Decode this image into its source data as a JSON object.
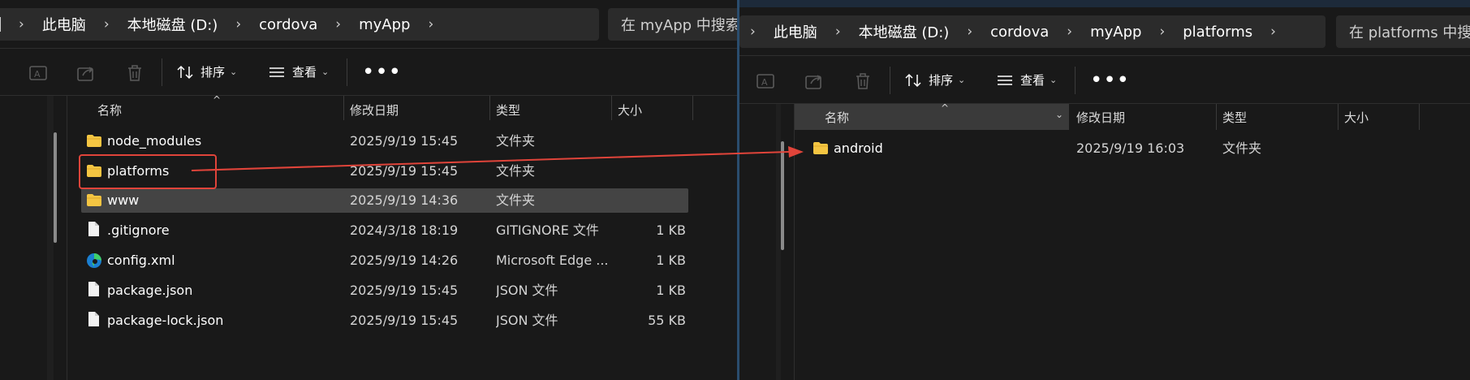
{
  "left": {
    "breadcrumb": [
      "此电脑",
      "本地磁盘 (D:)",
      "cordova",
      "myApp"
    ],
    "search_placeholder": "在 myApp 中搜索",
    "toolbar": {
      "sort_label": "排序",
      "view_label": "查看",
      "more_label": "•••"
    },
    "columns": {
      "name": "名称",
      "date": "修改日期",
      "type": "类型",
      "size": "大小"
    },
    "rows": [
      {
        "icon": "folder-icon",
        "name": "node_modules",
        "date": "2025/9/19 15:45",
        "type": "文件夹",
        "size": ""
      },
      {
        "icon": "folder-icon",
        "name": "platforms",
        "date": "2025/9/19 15:45",
        "type": "文件夹",
        "size": ""
      },
      {
        "icon": "folder-icon",
        "name": "www",
        "date": "2025/9/19 14:36",
        "type": "文件夹",
        "size": "",
        "selected": true
      },
      {
        "icon": "file-icon",
        "name": ".gitignore",
        "date": "2024/3/18 18:19",
        "type": "GITIGNORE 文件",
        "size": "1 KB"
      },
      {
        "icon": "edge-icon",
        "name": "config.xml",
        "date": "2025/9/19 14:26",
        "type": "Microsoft Edge ...",
        "size": "1 KB"
      },
      {
        "icon": "file-icon",
        "name": "package.json",
        "date": "2025/9/19 15:45",
        "type": "JSON 文件",
        "size": "1 KB"
      },
      {
        "icon": "file-icon",
        "name": "package-lock.json",
        "date": "2025/9/19 15:45",
        "type": "JSON 文件",
        "size": "55 KB"
      }
    ]
  },
  "right": {
    "breadcrumb": [
      "此电脑",
      "本地磁盘 (D:)",
      "cordova",
      "myApp",
      "platforms"
    ],
    "search_placeholder": "在 platforms 中搜索",
    "toolbar": {
      "sort_label": "排序",
      "view_label": "查看",
      "more_label": "•••"
    },
    "columns": {
      "name": "名称",
      "date": "修改日期",
      "type": "类型",
      "size": "大小"
    },
    "rows": [
      {
        "icon": "folder-icon",
        "name": "android",
        "date": "2025/9/19 16:03",
        "type": "文件夹",
        "size": ""
      }
    ]
  },
  "colors": {
    "background": "#191919",
    "folder": "#f4c542",
    "annotation": "#e0443a",
    "selected_row": "#444444",
    "header_active": "#3a3a3a"
  }
}
